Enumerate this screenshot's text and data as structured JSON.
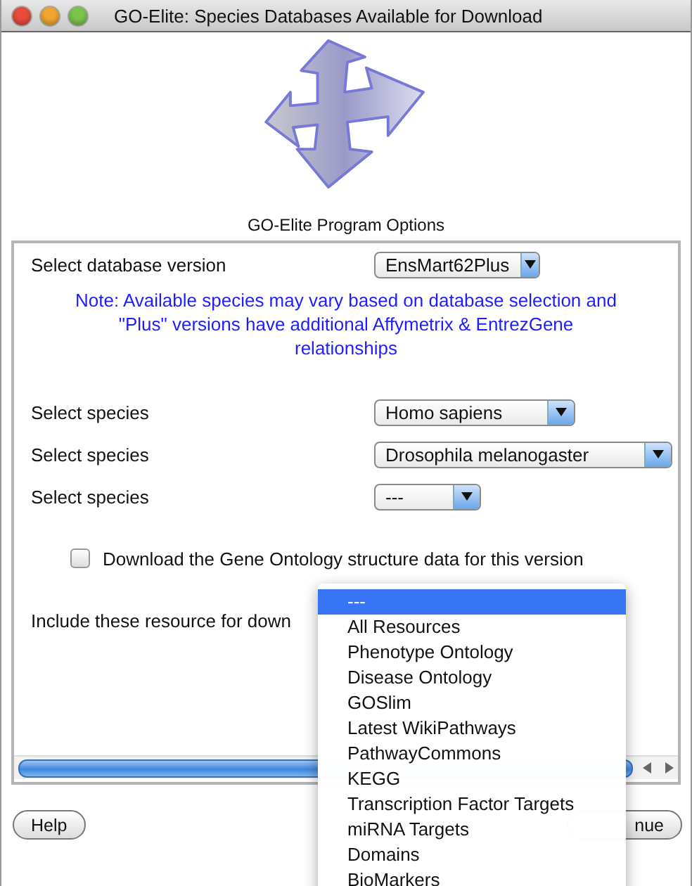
{
  "window": {
    "title": "GO-Elite: Species Databases Available for Download"
  },
  "section_title": "GO-Elite Program Options",
  "database_version": {
    "label": "Select database version",
    "value": "EnsMart62Plus"
  },
  "note": "Note:   Available species may vary based on database selection and \"Plus\" versions have additional Affymetrix & EntrezGene relationships",
  "species": [
    {
      "label": "Select species",
      "value": "Homo sapiens"
    },
    {
      "label": "Select species",
      "value": "Drosophila melanogaster"
    },
    {
      "label": "Select species",
      "value": "---"
    }
  ],
  "ontology_checkbox": {
    "label": "Download the Gene Ontology structure data for this version",
    "checked": false
  },
  "resources_label": "Include these resource for down",
  "resources_menu": {
    "items": [
      {
        "label": "---",
        "selected": true
      },
      {
        "label": "All Resources",
        "selected": false
      },
      {
        "label": "Phenotype Ontology",
        "selected": false
      },
      {
        "label": "Disease Ontology",
        "selected": false
      },
      {
        "label": "GOSlim",
        "selected": false
      },
      {
        "label": "Latest WikiPathways",
        "selected": false
      },
      {
        "label": "PathwayCommons",
        "selected": false
      },
      {
        "label": "KEGG",
        "selected": false
      },
      {
        "label": "Transcription Factor Targets",
        "selected": false
      },
      {
        "label": "miRNA Targets",
        "selected": false
      },
      {
        "label": "Domains",
        "selected": false
      },
      {
        "label": "BioMarkers",
        "selected": false
      }
    ]
  },
  "buttons": {
    "help": "Help",
    "continue": "nue"
  }
}
